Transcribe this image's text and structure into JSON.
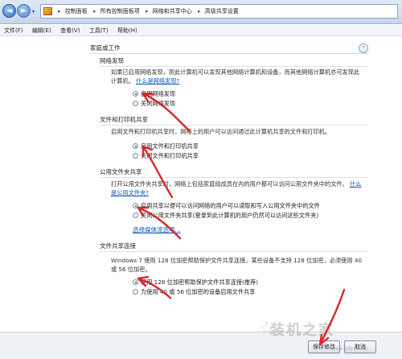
{
  "address_bar": {
    "back_glyph": "◄",
    "forward_glyph": "►",
    "history_glyph": "▾",
    "crumbs": [
      "控制面板",
      "所有控制面板项",
      "网络和共享中心",
      "高级共享设置"
    ],
    "separator": "▸"
  },
  "menu": [
    "文件(F)",
    "编辑(E)",
    "查看(V)",
    "工具(T)",
    "帮助(H)"
  ],
  "profile": {
    "title": "家庭或工作",
    "collapse_glyph": "⌃"
  },
  "sections": {
    "discovery": {
      "title": "网络发现",
      "desc": "如果已启用网络发现，则此计算机可以发现其他网络计算机和设备，而其他网络计算机亦可发现此计算机。",
      "link": "什么是网络发现?",
      "options": [
        "启用网络发现",
        "关闭网络发现"
      ]
    },
    "file_printer": {
      "title": "文件和打印机共享",
      "desc": "启用文件和打印机共享时，网络上的用户可以访问通过此计算机共享的文件和打印机。",
      "options": [
        "启用文件和打印机共享",
        "关闭文件和打印机共享"
      ]
    },
    "public_folder": {
      "title": "公用文件夹共享",
      "desc": "打开公用文件夹共享时，网络上包括家庭组成员在内的用户都可以访问公用文件夹中的文件。",
      "link": "什么是公用文件夹?",
      "options": [
        "启用共享以便可以访问网络的用户可以读取和写入公用文件夹中的文件",
        "关闭公用文件夹共享(登录到此计算机的用户仍然可以访问这些文件夹)"
      ],
      "extra_link": "选择媒体流选项..."
    },
    "connection": {
      "title": "文件共享连接",
      "desc": "Windows 7 使用 128 位加密帮助保护文件共享连接。某些设备不支持 128 位加密，必须使用 40 或 56 位加密。",
      "options": [
        "使用 128 位加密帮助保护文件共享连接(推荐)",
        "为使用 40 或 56 位加密的设备启用文件共享"
      ]
    }
  },
  "buttons": {
    "save": "保存修改",
    "cancel": "取消"
  },
  "watermark": {
    "text": "装机之家",
    "url": "www.lotpc.com"
  },
  "colors": {
    "link": "#0b56c4",
    "arrow": "#d8262b"
  }
}
